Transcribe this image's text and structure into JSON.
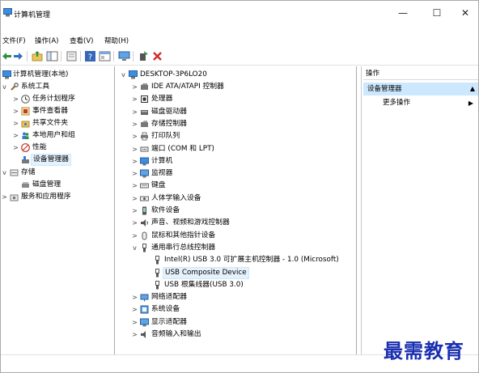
{
  "window": {
    "title": "计算机管理",
    "min_icon": "minimize-icon",
    "max_icon": "maximize-icon",
    "close_icon": "close-icon",
    "min_glyph": "—",
    "max_glyph": "☐",
    "close_glyph": "✕"
  },
  "menu": [
    {
      "label": "文件(F)"
    },
    {
      "label": "操作(A)"
    },
    {
      "label": "查看(V)"
    },
    {
      "label": "帮助(H)"
    }
  ],
  "toolbar": {
    "icons": [
      "back-icon",
      "forward-icon",
      "up-folder-icon",
      "show-hide-tree-icon",
      "export-icon",
      "help-icon",
      "properties-icon",
      "monitor-icon",
      "scan-hardware-icon",
      "uninstall-icon"
    ]
  },
  "left_tree": [
    {
      "label": "计算机管理(本地)",
      "exp": "",
      "icon": "computer-management-icon"
    },
    {
      "label": "系统工具",
      "exp": "v",
      "icon": "tools-icon"
    },
    {
      "label": "任务计划程序",
      "exp": ">",
      "icon": "clock-icon"
    },
    {
      "label": "事件查看器",
      "exp": ">",
      "icon": "event-viewer-icon"
    },
    {
      "label": "共享文件夹",
      "exp": ">",
      "icon": "shared-folder-icon"
    },
    {
      "label": "本地用户和组",
      "exp": ">",
      "icon": "users-icon"
    },
    {
      "label": "性能",
      "exp": ">",
      "icon": "performance-icon"
    },
    {
      "label": "设备管理器",
      "exp": "",
      "icon": "device-manager-icon"
    },
    {
      "label": "存储",
      "exp": "v",
      "icon": "storage-icon"
    },
    {
      "label": "磁盘管理",
      "exp": "",
      "icon": "disk-management-icon"
    },
    {
      "label": "服务和应用程序",
      "exp": ">",
      "icon": "services-icon"
    }
  ],
  "device_tree": {
    "root": "DESKTOP-3P6LO20",
    "items": [
      {
        "label": "IDE ATA/ATAPI 控制器",
        "exp": ">",
        "icon": "ide-controller-icon"
      },
      {
        "label": "处理器",
        "exp": ">",
        "icon": "processor-icon"
      },
      {
        "label": "磁盘驱动器",
        "exp": ">",
        "icon": "disk-drive-icon"
      },
      {
        "label": "存储控制器",
        "exp": ">",
        "icon": "storage-controller-icon"
      },
      {
        "label": "打印队列",
        "exp": ">",
        "icon": "printer-icon"
      },
      {
        "label": "端口 (COM 和 LPT)",
        "exp": ">",
        "icon": "port-icon"
      },
      {
        "label": "计算机",
        "exp": ">",
        "icon": "computer-icon"
      },
      {
        "label": "监视器",
        "exp": ">",
        "icon": "monitor-icon"
      },
      {
        "label": "键盘",
        "exp": ">",
        "icon": "keyboard-icon"
      },
      {
        "label": "人体学输入设备",
        "exp": ">",
        "icon": "hid-icon"
      },
      {
        "label": "软件设备",
        "exp": ">",
        "icon": "software-device-icon"
      },
      {
        "label": "声音、视频和游戏控制器",
        "exp": ">",
        "icon": "sound-icon"
      },
      {
        "label": "鼠标和其他指针设备",
        "exp": ">",
        "icon": "mouse-icon"
      },
      {
        "label": "通用串行总线控制器",
        "exp": "v",
        "icon": "usb-icon"
      },
      {
        "label": "Intel(R) USB 3.0 可扩展主机控制器 - 1.0 (Microsoft)",
        "exp": "",
        "icon": "usb-device-icon",
        "child": true
      },
      {
        "label": "USB Composite Device",
        "exp": "",
        "icon": "usb-device-icon",
        "child": true,
        "selected": true
      },
      {
        "label": "USB 根集线器(USB 3.0)",
        "exp": "",
        "icon": "usb-device-icon",
        "child": true
      },
      {
        "label": "网络适配器",
        "exp": ">",
        "icon": "network-icon"
      },
      {
        "label": "系统设备",
        "exp": ">",
        "icon": "system-device-icon"
      },
      {
        "label": "显示适配器",
        "exp": ">",
        "icon": "display-adapter-icon"
      },
      {
        "label": "音频输入和输出",
        "exp": ">",
        "icon": "audio-icon"
      }
    ]
  },
  "actions": {
    "header": "操作",
    "section": "设备管理器",
    "more": "更多操作",
    "section_glyph": "▲",
    "more_glyph": "▶"
  },
  "watermark": "最需教育",
  "colors": {
    "selection": "#cce8ff",
    "watermark": "#1a2fb0"
  }
}
